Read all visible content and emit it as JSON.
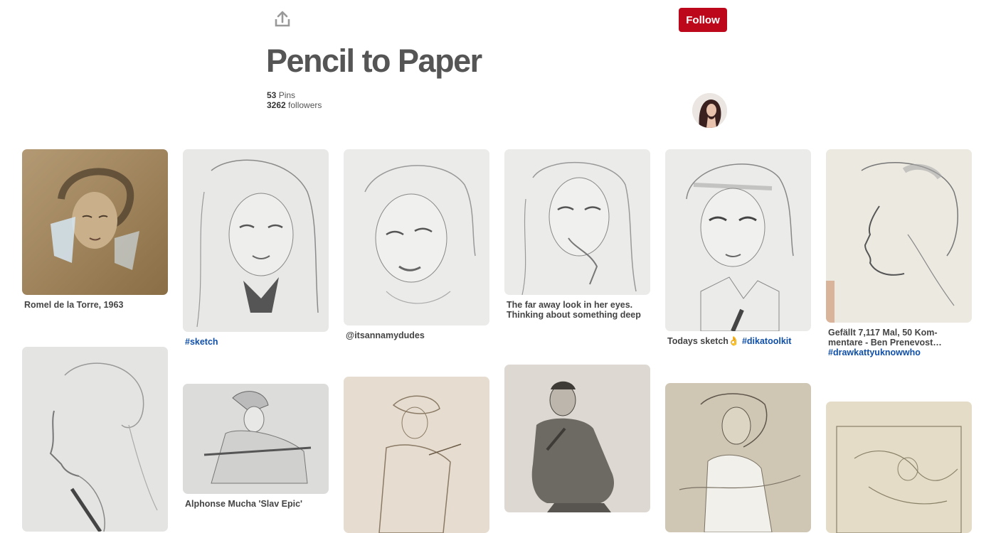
{
  "header": {
    "follow_label": "Follow",
    "title": "Pencil to Paper",
    "pins_count": "53",
    "pins_label": "Pins",
    "followers_count": "3262",
    "followers_label": "followers"
  },
  "colors": {
    "follow_button": "#bd081c",
    "hashtag": "#0f4fa8",
    "title": "#555555"
  },
  "pins": [
    {
      "caption": "Romel de la Torre, 1963",
      "tag": ""
    },
    {
      "caption": "",
      "tag": "#sketch"
    },
    {
      "caption": "@itsannamydudes",
      "tag": ""
    },
    {
      "caption": "The far away look in her eyes. Thinking about something deep",
      "tag": ""
    },
    {
      "caption": "Todays sketch👌",
      "tag": "#dikatoolkit"
    },
    {
      "caption": "Gefällt 7,117 Mal, 50 Kom-mentare - Ben Prenevost…",
      "tag": "#drawkattyuknowwho"
    },
    {
      "caption": "",
      "tag": ""
    },
    {
      "caption": "Alphonse Mucha 'Slav Epic'",
      "tag": ""
    },
    {
      "caption": "",
      "tag": ""
    },
    {
      "caption": "",
      "tag": ""
    },
    {
      "caption": "",
      "tag": ""
    },
    {
      "caption": "",
      "tag": ""
    }
  ]
}
